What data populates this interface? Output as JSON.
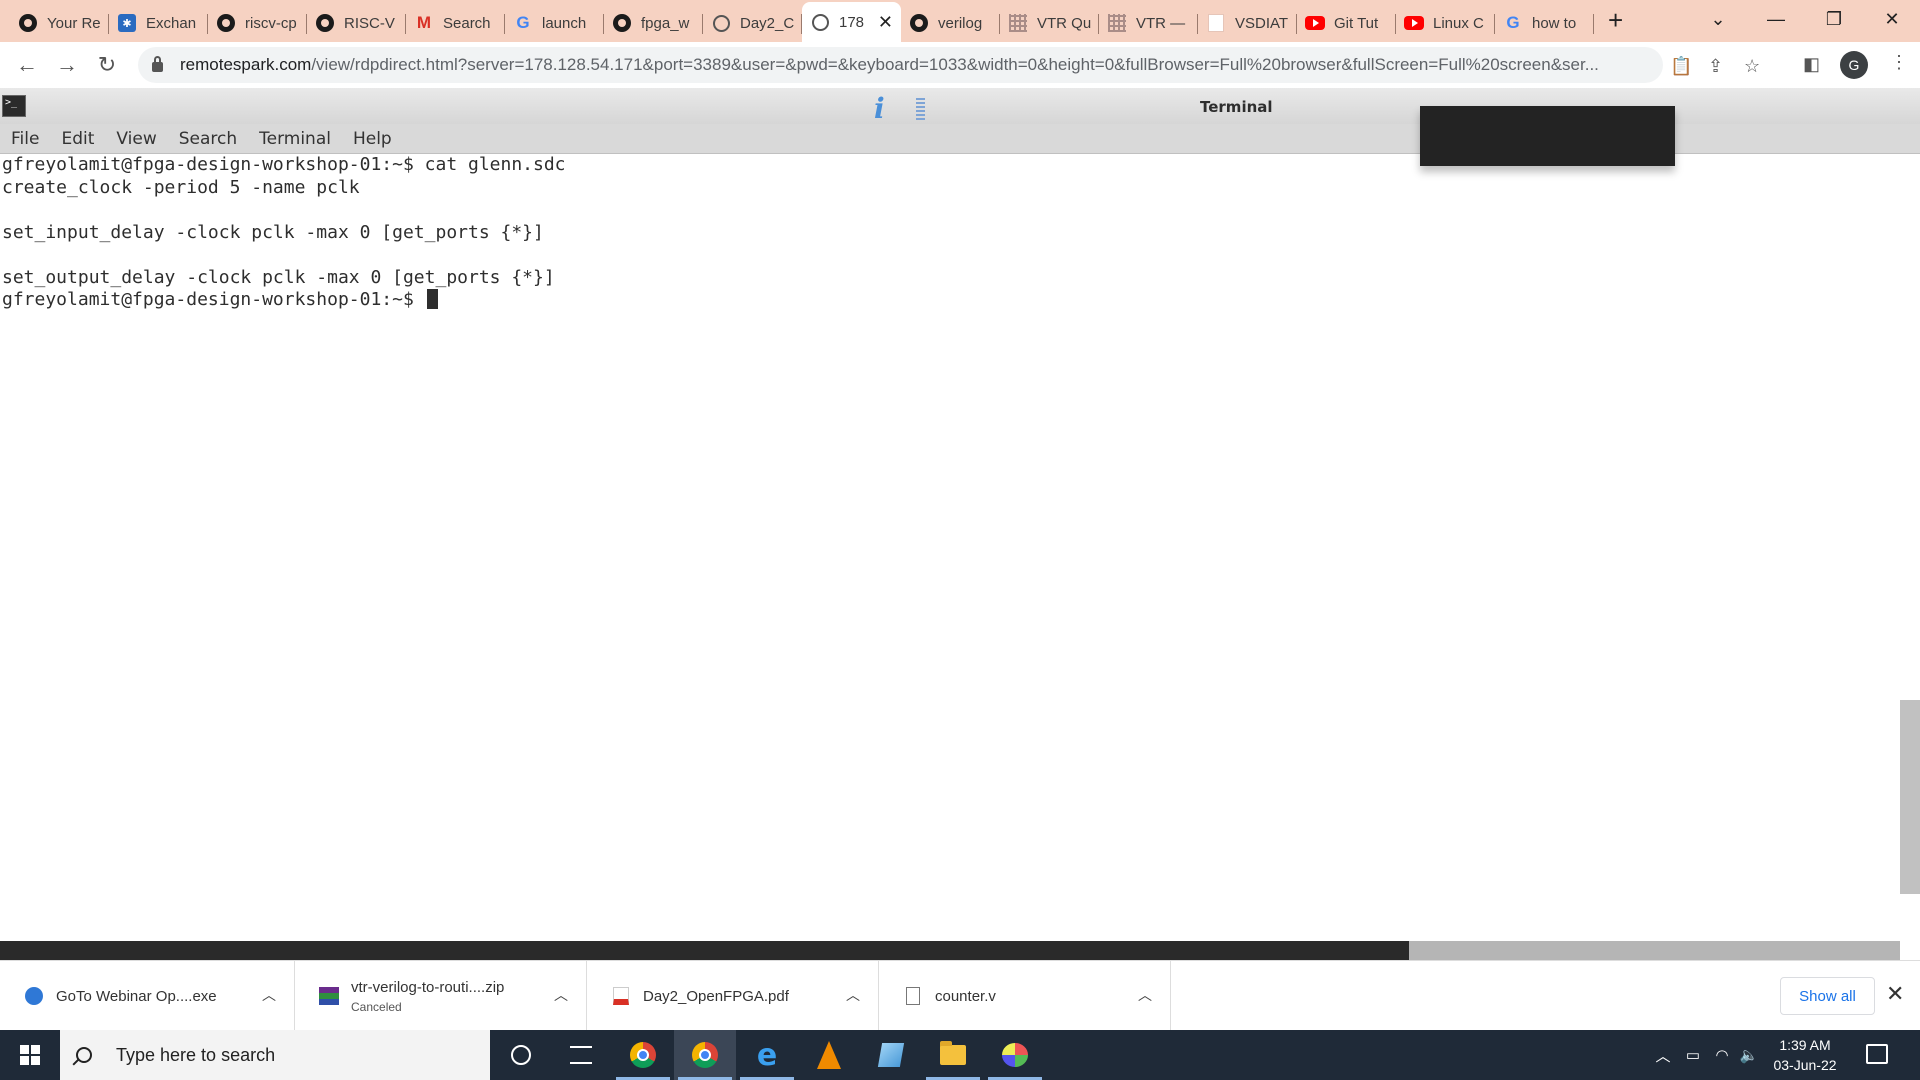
{
  "browser": {
    "tabs": [
      {
        "label": "Your Re",
        "icon": "github-icon"
      },
      {
        "label": "Exchan",
        "icon": "exchange-icon"
      },
      {
        "label": "riscv-cp",
        "icon": "github-icon"
      },
      {
        "label": "RISC-V",
        "icon": "github-icon"
      },
      {
        "label": "Search",
        "icon": "gmail-icon"
      },
      {
        "label": "launch",
        "icon": "google-icon"
      },
      {
        "label": "fpga_w",
        "icon": "github-icon"
      },
      {
        "label": "Day2_C",
        "icon": "globe-icon"
      },
      {
        "label": "178",
        "icon": "globe-icon",
        "active": true
      },
      {
        "label": "verilog",
        "icon": "github-icon"
      },
      {
        "label": "VTR Qu",
        "icon": "grid-icon"
      },
      {
        "label": "VTR —",
        "icon": "grid-icon"
      },
      {
        "label": "VSDIAT",
        "icon": "blank-page-icon"
      },
      {
        "label": "Git Tut",
        "icon": "youtube-icon"
      },
      {
        "label": "Linux C",
        "icon": "youtube-icon"
      },
      {
        "label": "how to",
        "icon": "google-icon"
      }
    ],
    "url_host": "remotespark.com",
    "url_rest": "/view/rdpdirect.html?server=178.128.54.171&port=3389&user=&pwd=&keyboard=1033&width=0&height=0&fullBrowser=Full%20browser&fullScreen=Full%20screen&ser...",
    "profile_initial": "G"
  },
  "terminal": {
    "title": "Terminal",
    "menu": [
      "File",
      "Edit",
      "View",
      "Search",
      "Terminal",
      "Help"
    ],
    "lines": [
      "gfreyolamit@fpga-design-workshop-01:~$ cat glenn.sdc",
      "create_clock -period 5 -name pclk",
      "",
      "set_input_delay -clock pclk -max 0 [get_ports {*}]",
      "",
      "set_output_delay -clock pclk -max 0 [get_ports {*}]"
    ],
    "prompt": "gfreyolamit@fpga-design-workshop-01:~$ "
  },
  "downloads": {
    "items": [
      {
        "name": "GoTo Webinar Op....exe",
        "status": ""
      },
      {
        "name": "vtr-verilog-to-routi....zip",
        "status": "Canceled"
      },
      {
        "name": "Day2_OpenFPGA.pdf",
        "status": ""
      },
      {
        "name": "counter.v",
        "status": ""
      }
    ],
    "show_all": "Show all"
  },
  "taskbar": {
    "search_placeholder": "Type here to search",
    "time": "1:39 AM",
    "date": "03-Jun-22"
  }
}
